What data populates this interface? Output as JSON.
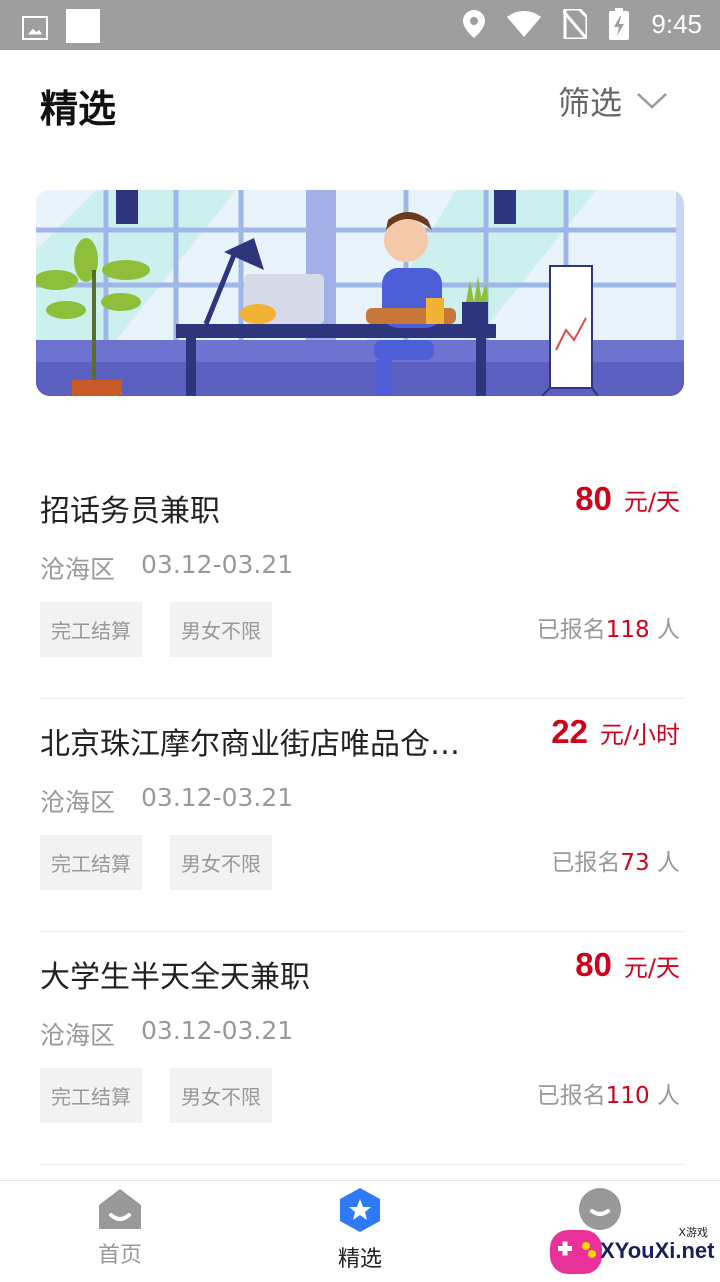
{
  "status_bar": {
    "time": "9:45"
  },
  "header": {
    "title": "精选",
    "filter_label": "筛选"
  },
  "jobs": [
    {
      "title": "招话务员兼职",
      "salary": "80",
      "unit": "元/天",
      "district": "沧海区",
      "dates": "03.12-03.21",
      "tags": [
        "完工结算",
        "男女不限"
      ],
      "enrolled_prefix": "已报名",
      "enrolled_count": "118",
      "enrolled_suffix": " 人"
    },
    {
      "title": "北京珠江摩尔商业街店唯品仓…",
      "salary": "22",
      "unit": "元/小时",
      "district": "沧海区",
      "dates": "03.12-03.21",
      "tags": [
        "完工结算",
        "男女不限"
      ],
      "enrolled_prefix": "已报名",
      "enrolled_count": "73",
      "enrolled_suffix": " 人"
    },
    {
      "title": "大学生半天全天兼职",
      "salary": "80",
      "unit": "元/天",
      "district": "沧海区",
      "dates": "03.12-03.21",
      "tags": [
        "完工结算",
        "男女不限"
      ],
      "enrolled_prefix": "已报名",
      "enrolled_count": "110",
      "enrolled_suffix": " 人"
    }
  ],
  "tabbar": {
    "items": [
      {
        "label": "首页",
        "icon": "home-icon"
      },
      {
        "label": "精选",
        "icon": "star-badge-icon"
      },
      {
        "label": "",
        "icon": "profile-icon"
      }
    ]
  },
  "watermark": {
    "main": "XYouXi.net",
    "small": "X游戏"
  },
  "colors": {
    "accent": "#d0021b",
    "tab_active": "#2f7bf5",
    "tab_inactive": "#999999"
  }
}
